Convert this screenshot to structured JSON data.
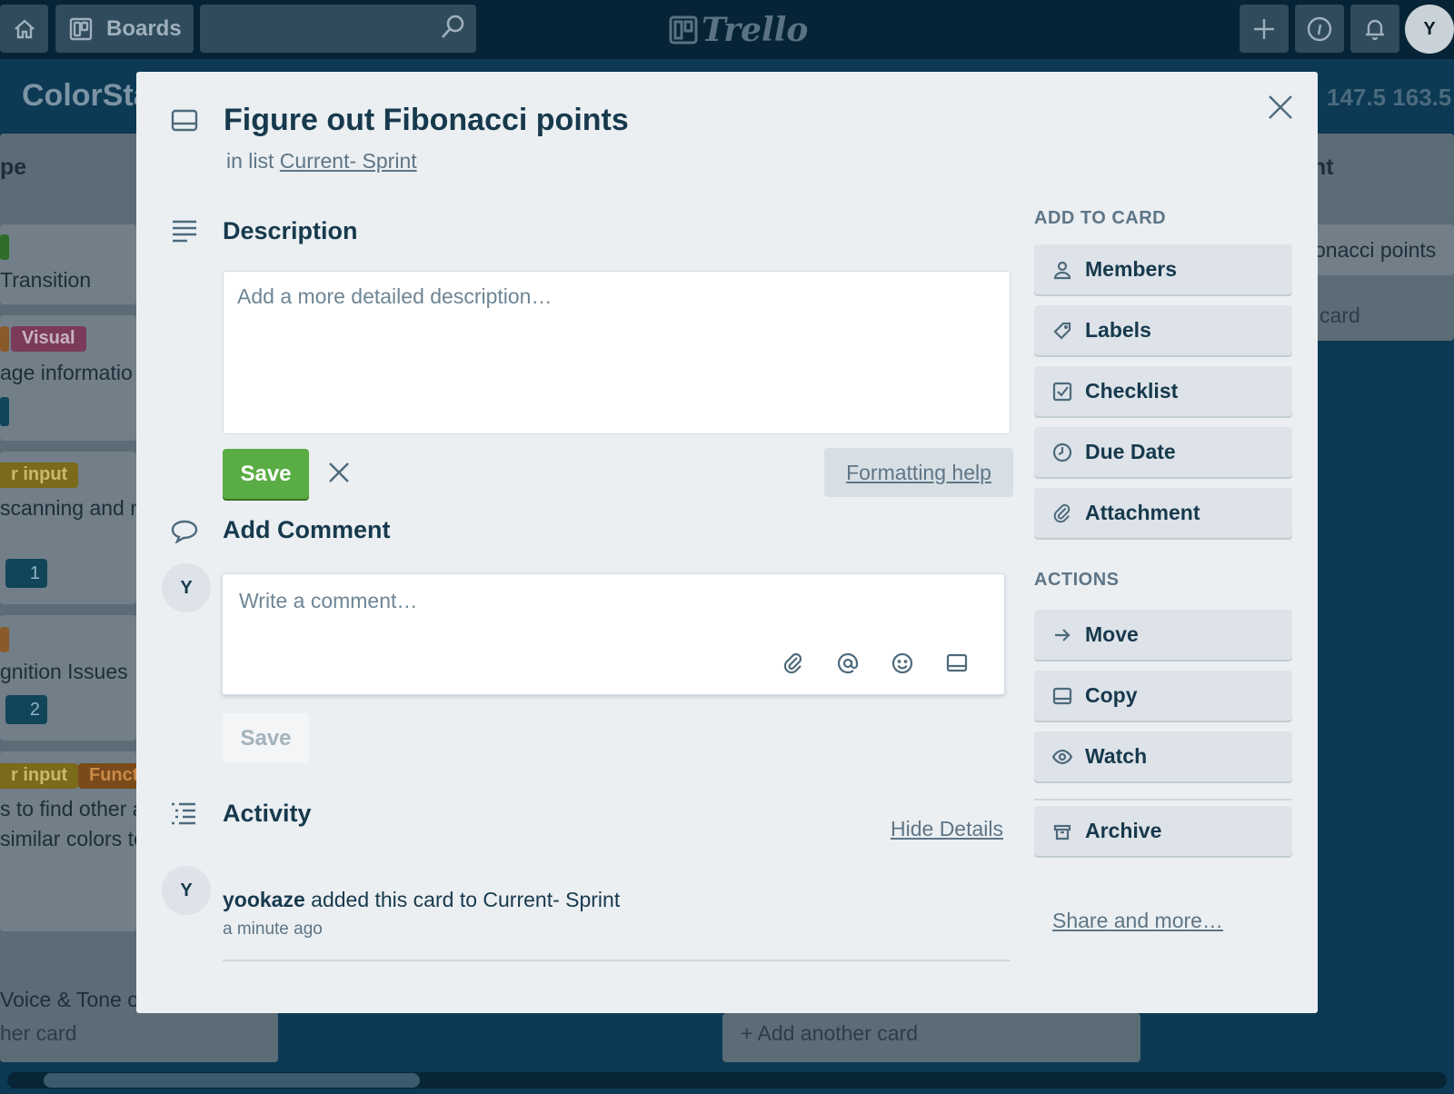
{
  "topnav": {
    "boards_label": "Boards",
    "logo_text": "Trello",
    "user_initial": "Y"
  },
  "board": {
    "title": "ColorSta",
    "stats": "147.5 163.5"
  },
  "background": {
    "left_list_header": "pe",
    "left_cards": [
      {
        "text": "Transition"
      },
      {
        "label": "Visual",
        "text": "age informatio"
      },
      {
        "label": "r input",
        "text": "scanning and n",
        "badge": "1"
      },
      {
        "text": "gnition Issues",
        "badge": "2"
      },
      {
        "labels": [
          "r input",
          "Funct"
        ],
        "text_lines": [
          "s to find other a",
          "similar colors to"
        ]
      },
      {
        "text": "Voice & Tone of"
      }
    ],
    "left_add_card": "her card",
    "right_list_header": "nt",
    "right_card_text": "onacci points",
    "right_add_card": "card",
    "middle_add_card": "+ Add another card"
  },
  "card": {
    "title": "Figure out Fibonacci points",
    "in_list_prefix": "in list",
    "list_name": "Current- Sprint",
    "close_icon": "close-icon"
  },
  "description": {
    "heading": "Description",
    "placeholder": "Add a more detailed description…",
    "save_label": "Save",
    "formatting_help": "Formatting help"
  },
  "comment": {
    "heading": "Add Comment",
    "avatar_initial": "Y",
    "placeholder": "Write a comment…",
    "save_label": "Save"
  },
  "activity": {
    "heading": "Activity",
    "hide_details": "Hide Details",
    "entries": [
      {
        "avatar_initial": "Y",
        "user": "yookaze",
        "text": "added this card to Current- Sprint",
        "time": "a minute ago"
      }
    ]
  },
  "sidebar": {
    "add_heading": "ADD TO CARD",
    "add_items": [
      {
        "label": "Members",
        "icon": "person-icon"
      },
      {
        "label": "Labels",
        "icon": "tag-icon"
      },
      {
        "label": "Checklist",
        "icon": "checklist-icon"
      },
      {
        "label": "Due Date",
        "icon": "clock-icon"
      },
      {
        "label": "Attachment",
        "icon": "paperclip-icon"
      }
    ],
    "actions_heading": "ACTIONS",
    "action_items": [
      {
        "label": "Move",
        "icon": "arrow-right-icon"
      },
      {
        "label": "Copy",
        "icon": "card-icon"
      },
      {
        "label": "Watch",
        "icon": "eye-icon"
      },
      {
        "label": "Archive",
        "icon": "archive-icon"
      }
    ],
    "share_more": "Share and more…"
  },
  "colors": {
    "save_green": "#5aac44",
    "modal_bg": "#ebeff2",
    "nav_bg": "#062435",
    "board_bg": "#0c3953"
  }
}
